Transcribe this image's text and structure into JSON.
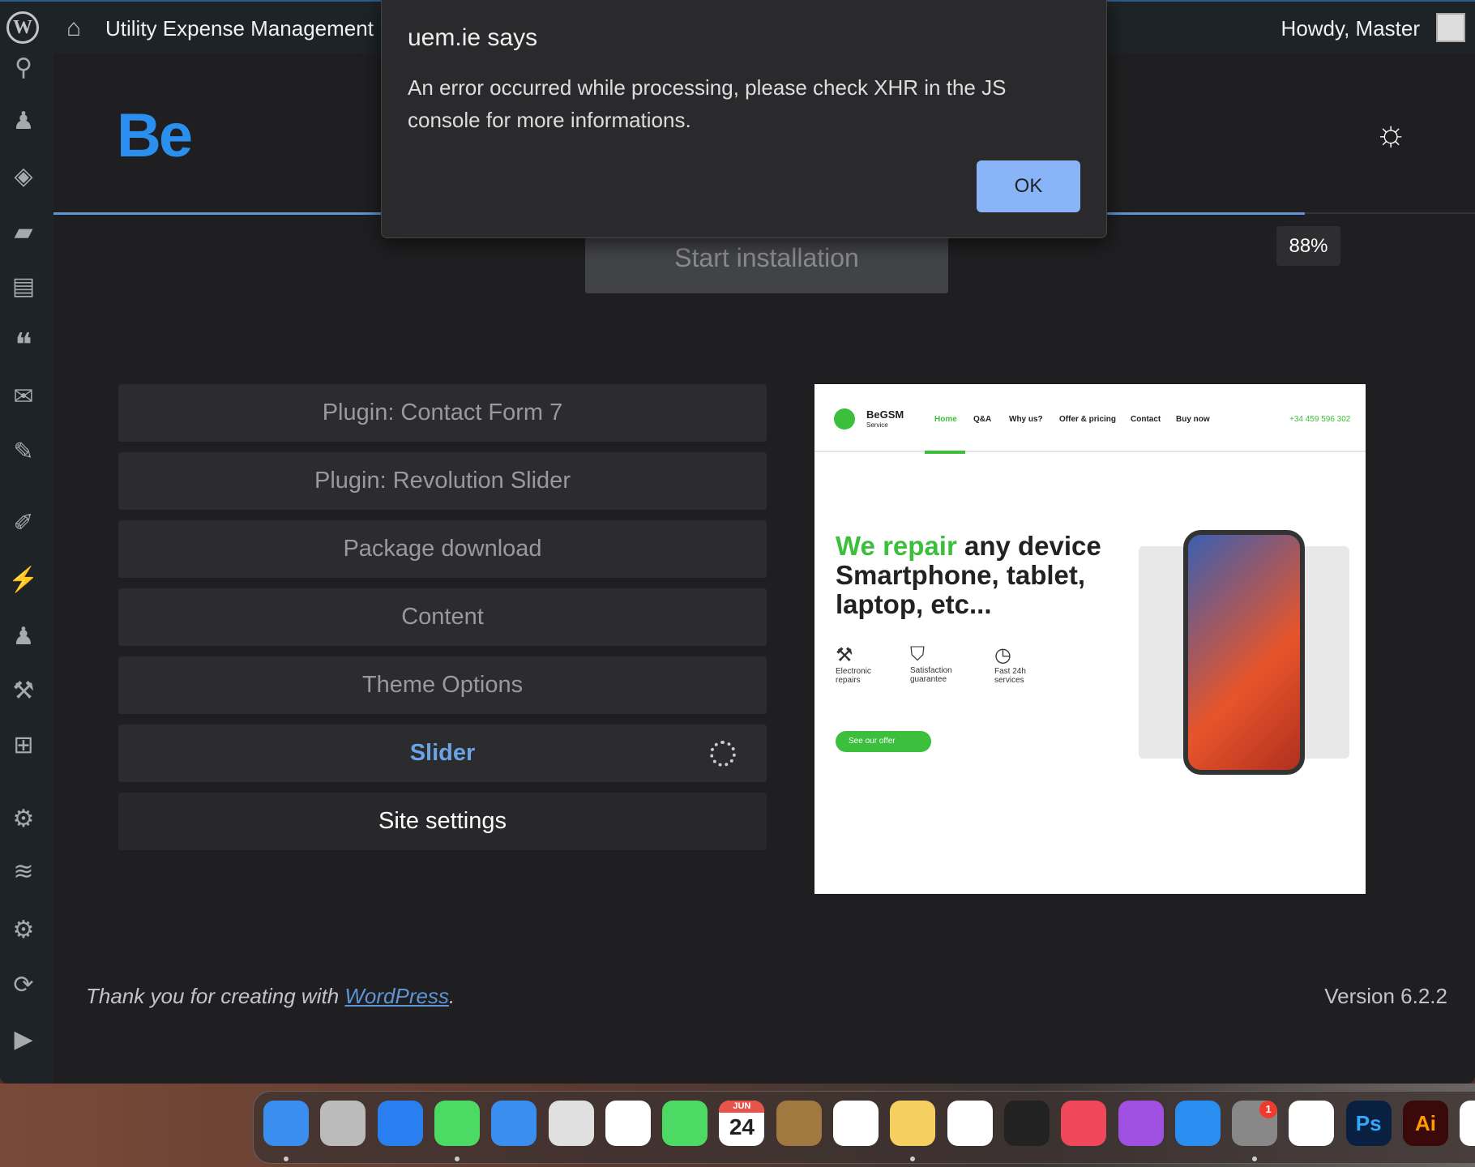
{
  "admin_bar": {
    "site_name": "Utility Expense Management",
    "howdy": "Howdy, Master"
  },
  "sidebar": {
    "icons": [
      "wordpress-icon",
      "hubspot-icon",
      "users-icon",
      "tag-icon",
      "folder-icon",
      "slides-icon",
      "quote-icon",
      "mail-icon",
      "edit-icon",
      "brush-icon",
      "plugin-icon",
      "user-icon",
      "wrench-icon",
      "add-icon",
      "gear-icon",
      "layers-icon",
      "settings-icon",
      "sync-icon",
      "play-icon"
    ]
  },
  "header": {
    "logo": "Be",
    "theme_toggle_icon": "sun-icon"
  },
  "progress": {
    "percent": 88,
    "label": "88%"
  },
  "start_button": "Start installation",
  "steps": [
    {
      "label": "Plugin: Contact Form 7",
      "state": "done"
    },
    {
      "label": "Plugin: Revolution Slider",
      "state": "done"
    },
    {
      "label": "Package download",
      "state": "done"
    },
    {
      "label": "Content",
      "state": "done"
    },
    {
      "label": "Theme Options",
      "state": "done"
    },
    {
      "label": "Slider",
      "state": "active"
    },
    {
      "label": "Site settings",
      "state": "pending"
    }
  ],
  "preview": {
    "brand": "BeGSM",
    "brand_sub": "Service",
    "nav": [
      "Home",
      "Q&A",
      "Why us?",
      "Offer & pricing",
      "Contact",
      "Buy now"
    ],
    "phone": "+34 459 596 302",
    "hero_accent": "We repair",
    "hero_rest": " any device Smartphone, tablet, laptop, etc...",
    "features": [
      "Electronic repairs",
      "Satisfaction guarantee",
      "Fast 24h services"
    ],
    "cta": "See our offer"
  },
  "footer": {
    "thanks": "Thank you for creating with ",
    "link": "WordPress",
    "period": ".",
    "version": "Version 6.2.2"
  },
  "dialog": {
    "title": "uem.ie says",
    "message": "An error occurred while processing, please check XHR in the JS console for more informations.",
    "ok": "OK"
  },
  "dock": {
    "apps": [
      "Finder",
      "Launchpad",
      "Safari",
      "Messages",
      "Mail",
      "Maps",
      "Photos",
      "FaceTime",
      "Calendar",
      "Contacts",
      "Reminders",
      "Notes",
      "Freeform",
      "TV",
      "Music",
      "Podcasts",
      "App Store",
      "System Settings",
      "CapCut",
      "Ps",
      "Ai",
      "Chrome"
    ],
    "calendar_month": "JUN",
    "calendar_day": "24",
    "settings_badge": "1"
  }
}
